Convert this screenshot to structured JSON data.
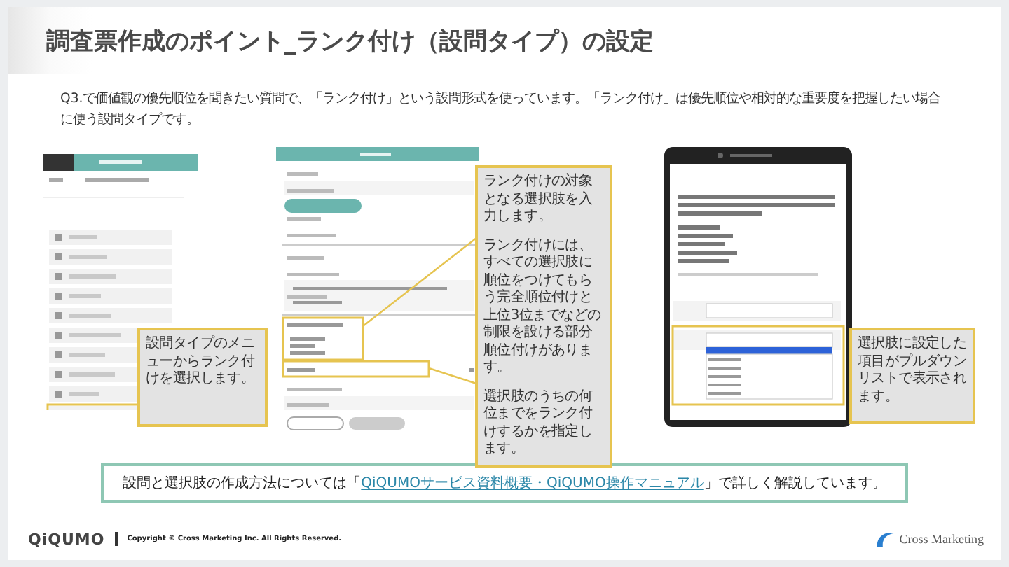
{
  "title": "調査票作成のポイント_ランク付け（設問タイプ）の設定",
  "intro": "Q3.で価値観の優先順位を聞きたい質問で、「ランク付け」という設問形式を使っています。「ランク付け」は優先順位や相対的な重要度を把握したい場合に使う設問タイプです。",
  "callouts": [
    {
      "paragraphs": [
        "設問タイプのメニューからランク付けを選択します。"
      ]
    },
    {
      "paragraphs": [
        "ランク付けの対象となる選択肢を入力します。",
        "ランク付けには、すべての選択肢に順位をつけてもらう完全順位付けと上位3位までなどの制限を設ける部分順位付けがあります。",
        "選択肢のうちの何位までをランク付けするかを指定します。"
      ]
    },
    {
      "paragraphs": [
        "選択肢に設定した項目がプルダウンリストで表示されます。"
      ]
    }
  ],
  "note": {
    "before": "設問と選択肢の作成方法については「",
    "link": "QiQUMOサービス資料概要・QiQUMO操作マニュアル",
    "after": "」で詳しく解説しています。"
  },
  "footer": {
    "brand": "QiQUMO",
    "copyright": "Copyright © Cross Marketing Inc. All Rights Reserved.",
    "company": "Cross Marketing"
  }
}
